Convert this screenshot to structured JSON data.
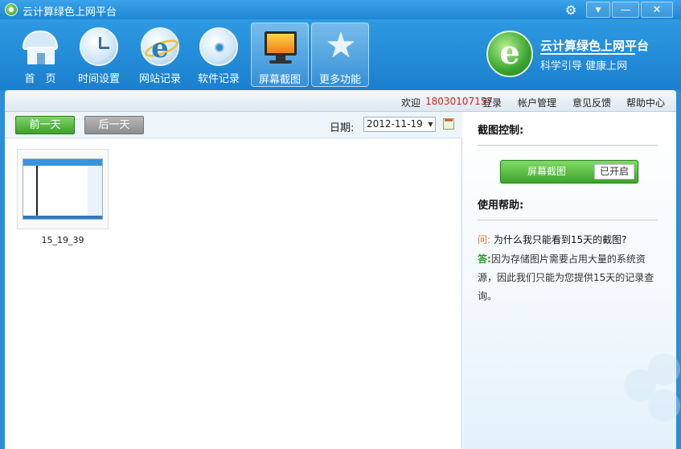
{
  "window": {
    "title": "云计算绿色上网平台",
    "menu_icon": "▾",
    "minimize": "—",
    "close": "✕"
  },
  "toolbar": {
    "items": [
      {
        "label": "首　页",
        "icon": "house-icon"
      },
      {
        "label": "时间设置",
        "icon": "clock-icon"
      },
      {
        "label": "网站记录",
        "icon": "ie-icon"
      },
      {
        "label": "软件记录",
        "icon": "cd-icon"
      },
      {
        "label": "屏幕截图",
        "icon": "monitor-icon",
        "active": true
      },
      {
        "label": "更多功能",
        "icon": "star-icon"
      }
    ]
  },
  "brand": {
    "title": "云计算绿色上网平台",
    "subtitle": "科学引导  健康上网",
    "logo_letter": "e"
  },
  "nav": {
    "welcome": "欢迎",
    "phone": "18030107157",
    "login": "登录",
    "account": "帐户管理",
    "feedback": "意见反馈",
    "help": "帮助中心"
  },
  "screenshots": {
    "prev_day": "前一天",
    "next_day": "后一天",
    "date_label": "日期:",
    "date_value": "2012-11-19",
    "items": [
      {
        "caption": "15_19_39"
      }
    ]
  },
  "panel": {
    "control_heading": "截图控制:",
    "toggle_label": "屏幕截图",
    "toggle_state": "已开启",
    "help_heading": "使用帮助:",
    "q_mark": "问",
    "question": "为什么我只能看到15天的截图?",
    "a_mark": "答",
    "answer": "因为存储图片需要占用大量的系统资源，因此我们只能为您提供15天的记录查询。"
  },
  "colors": {
    "accent_blue": "#2a8fd6",
    "green": "#3ea22c",
    "phone_red": "#d4201c"
  }
}
